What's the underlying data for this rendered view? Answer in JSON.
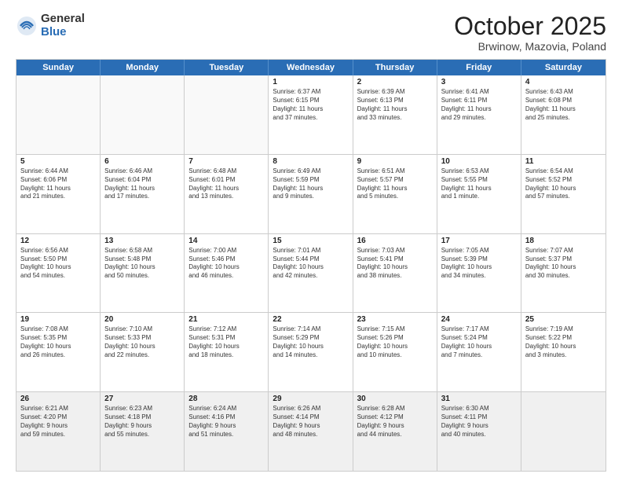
{
  "logo": {
    "general": "General",
    "blue": "Blue"
  },
  "title": "October 2025",
  "location": "Brwinow, Mazovia, Poland",
  "days": [
    "Sunday",
    "Monday",
    "Tuesday",
    "Wednesday",
    "Thursday",
    "Friday",
    "Saturday"
  ],
  "weeks": [
    [
      {
        "day": "",
        "text": ""
      },
      {
        "day": "",
        "text": ""
      },
      {
        "day": "",
        "text": ""
      },
      {
        "day": "1",
        "text": "Sunrise: 6:37 AM\nSunset: 6:15 PM\nDaylight: 11 hours\nand 37 minutes."
      },
      {
        "day": "2",
        "text": "Sunrise: 6:39 AM\nSunset: 6:13 PM\nDaylight: 11 hours\nand 33 minutes."
      },
      {
        "day": "3",
        "text": "Sunrise: 6:41 AM\nSunset: 6:11 PM\nDaylight: 11 hours\nand 29 minutes."
      },
      {
        "day": "4",
        "text": "Sunrise: 6:43 AM\nSunset: 6:08 PM\nDaylight: 11 hours\nand 25 minutes."
      }
    ],
    [
      {
        "day": "5",
        "text": "Sunrise: 6:44 AM\nSunset: 6:06 PM\nDaylight: 11 hours\nand 21 minutes."
      },
      {
        "day": "6",
        "text": "Sunrise: 6:46 AM\nSunset: 6:04 PM\nDaylight: 11 hours\nand 17 minutes."
      },
      {
        "day": "7",
        "text": "Sunrise: 6:48 AM\nSunset: 6:01 PM\nDaylight: 11 hours\nand 13 minutes."
      },
      {
        "day": "8",
        "text": "Sunrise: 6:49 AM\nSunset: 5:59 PM\nDaylight: 11 hours\nand 9 minutes."
      },
      {
        "day": "9",
        "text": "Sunrise: 6:51 AM\nSunset: 5:57 PM\nDaylight: 11 hours\nand 5 minutes."
      },
      {
        "day": "10",
        "text": "Sunrise: 6:53 AM\nSunset: 5:55 PM\nDaylight: 11 hours\nand 1 minute."
      },
      {
        "day": "11",
        "text": "Sunrise: 6:54 AM\nSunset: 5:52 PM\nDaylight: 10 hours\nand 57 minutes."
      }
    ],
    [
      {
        "day": "12",
        "text": "Sunrise: 6:56 AM\nSunset: 5:50 PM\nDaylight: 10 hours\nand 54 minutes."
      },
      {
        "day": "13",
        "text": "Sunrise: 6:58 AM\nSunset: 5:48 PM\nDaylight: 10 hours\nand 50 minutes."
      },
      {
        "day": "14",
        "text": "Sunrise: 7:00 AM\nSunset: 5:46 PM\nDaylight: 10 hours\nand 46 minutes."
      },
      {
        "day": "15",
        "text": "Sunrise: 7:01 AM\nSunset: 5:44 PM\nDaylight: 10 hours\nand 42 minutes."
      },
      {
        "day": "16",
        "text": "Sunrise: 7:03 AM\nSunset: 5:41 PM\nDaylight: 10 hours\nand 38 minutes."
      },
      {
        "day": "17",
        "text": "Sunrise: 7:05 AM\nSunset: 5:39 PM\nDaylight: 10 hours\nand 34 minutes."
      },
      {
        "day": "18",
        "text": "Sunrise: 7:07 AM\nSunset: 5:37 PM\nDaylight: 10 hours\nand 30 minutes."
      }
    ],
    [
      {
        "day": "19",
        "text": "Sunrise: 7:08 AM\nSunset: 5:35 PM\nDaylight: 10 hours\nand 26 minutes."
      },
      {
        "day": "20",
        "text": "Sunrise: 7:10 AM\nSunset: 5:33 PM\nDaylight: 10 hours\nand 22 minutes."
      },
      {
        "day": "21",
        "text": "Sunrise: 7:12 AM\nSunset: 5:31 PM\nDaylight: 10 hours\nand 18 minutes."
      },
      {
        "day": "22",
        "text": "Sunrise: 7:14 AM\nSunset: 5:29 PM\nDaylight: 10 hours\nand 14 minutes."
      },
      {
        "day": "23",
        "text": "Sunrise: 7:15 AM\nSunset: 5:26 PM\nDaylight: 10 hours\nand 10 minutes."
      },
      {
        "day": "24",
        "text": "Sunrise: 7:17 AM\nSunset: 5:24 PM\nDaylight: 10 hours\nand 7 minutes."
      },
      {
        "day": "25",
        "text": "Sunrise: 7:19 AM\nSunset: 5:22 PM\nDaylight: 10 hours\nand 3 minutes."
      }
    ],
    [
      {
        "day": "26",
        "text": "Sunrise: 6:21 AM\nSunset: 4:20 PM\nDaylight: 9 hours\nand 59 minutes."
      },
      {
        "day": "27",
        "text": "Sunrise: 6:23 AM\nSunset: 4:18 PM\nDaylight: 9 hours\nand 55 minutes."
      },
      {
        "day": "28",
        "text": "Sunrise: 6:24 AM\nSunset: 4:16 PM\nDaylight: 9 hours\nand 51 minutes."
      },
      {
        "day": "29",
        "text": "Sunrise: 6:26 AM\nSunset: 4:14 PM\nDaylight: 9 hours\nand 48 minutes."
      },
      {
        "day": "30",
        "text": "Sunrise: 6:28 AM\nSunset: 4:12 PM\nDaylight: 9 hours\nand 44 minutes."
      },
      {
        "day": "31",
        "text": "Sunrise: 6:30 AM\nSunset: 4:11 PM\nDaylight: 9 hours\nand 40 minutes."
      },
      {
        "day": "",
        "text": ""
      }
    ]
  ]
}
